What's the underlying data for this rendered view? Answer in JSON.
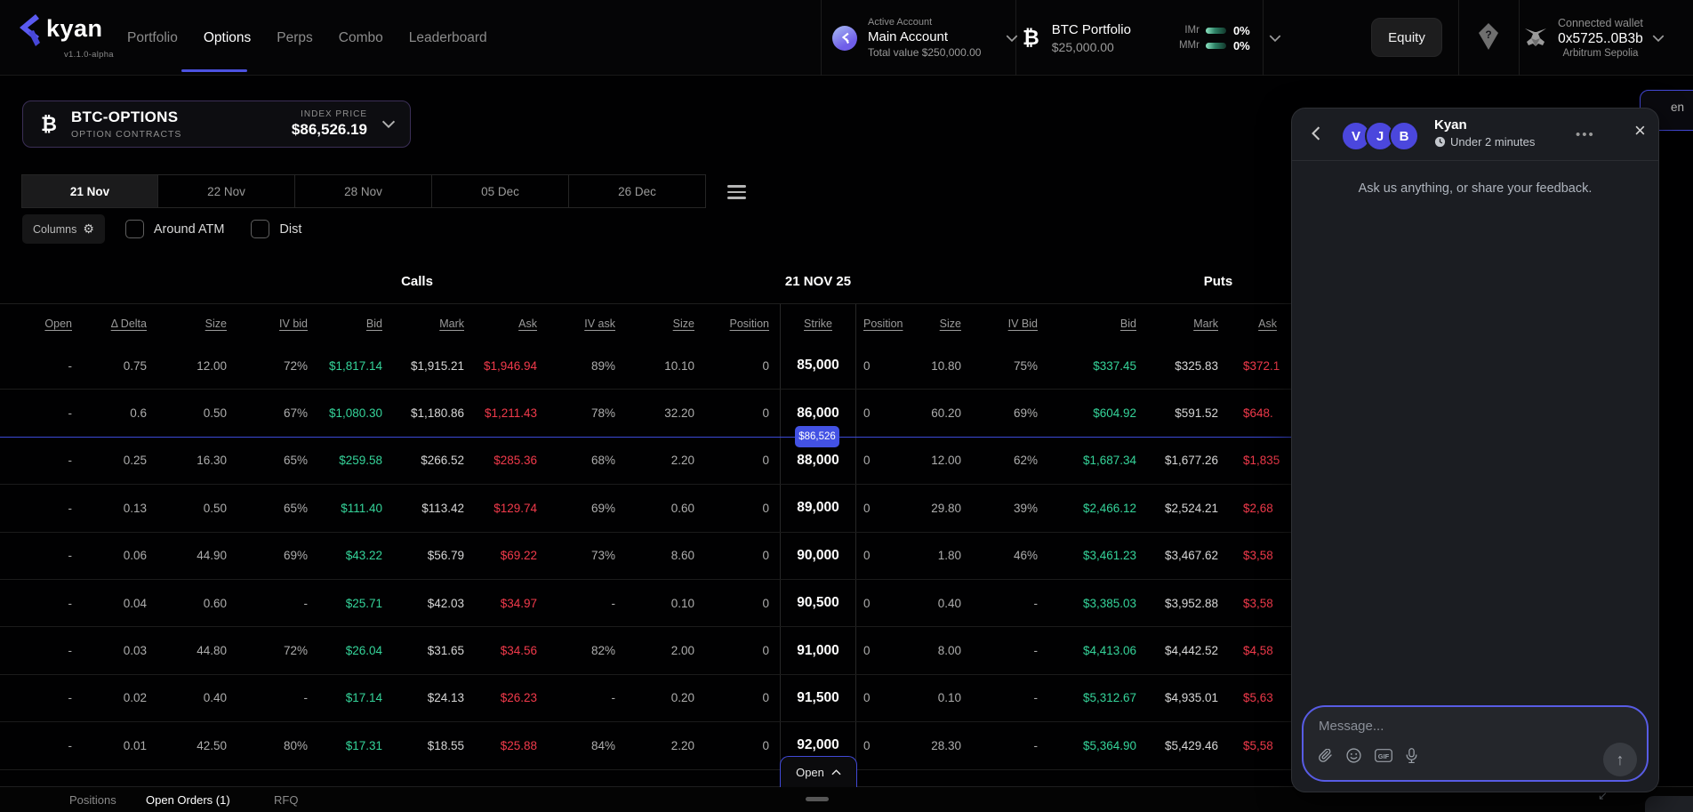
{
  "colors": {
    "accent_blue": "#4c52e0",
    "bid_green": "#35d49a",
    "ask_red": "#f13a4b",
    "badge_blue": "#4352e4"
  },
  "nav": {
    "brand": "kyan",
    "version": "v1.1.0-alpha",
    "items": [
      {
        "label": "Portfolio",
        "active": false
      },
      {
        "label": "Options",
        "active": true
      },
      {
        "label": "Perps",
        "active": false
      },
      {
        "label": "Combo",
        "active": false
      },
      {
        "label": "Leaderboard",
        "active": false
      }
    ],
    "account": {
      "label": "Active Account",
      "name": "Main Account",
      "total": "Total value $250,000.00"
    },
    "portfolio": {
      "name": "BTC Portfolio",
      "value": "$25,000.00",
      "imr_label": "IMr",
      "imr_value": "0%",
      "mmr_label": "MMr",
      "mmr_value": "0%",
      "btc_glyph": "₿"
    },
    "equity_button": "Equity",
    "help_icon": "?",
    "wallet": {
      "label": "Connected wallet",
      "address": "0x5725..0B3b",
      "network": "Arbitrum Sepolia"
    }
  },
  "market": {
    "btc_glyph": "₿",
    "name": "BTC-OPTIONS",
    "subtitle": "OPTION CONTRACTS",
    "index_label": "INDEX PRICE",
    "index_price": "$86,526.19"
  },
  "expiry_tabs": {
    "items": [
      "21 Nov",
      "22 Nov",
      "28 Nov",
      "05 Dec",
      "26 Dec"
    ],
    "active_index": 0
  },
  "filters": {
    "columns_label": "Columns",
    "around_atm_label": "Around ATM",
    "around_atm_checked": false,
    "dist_label": "Dist",
    "dist_checked": false
  },
  "chain": {
    "calls_label": "Calls",
    "expiry_label": "21 NOV 25",
    "puts_label": "Puts",
    "call_headers": [
      "Open",
      "Δ Delta",
      "Size",
      "IV bid",
      "Bid",
      "Mark",
      "Ask",
      "IV ask",
      "Size",
      "Position"
    ],
    "strike_header": "Strike",
    "put_headers": [
      "Position",
      "Size",
      "IV Bid",
      "Bid",
      "Mark",
      "Ask"
    ],
    "index_price_badge": "$86,526",
    "rows": [
      {
        "calls": [
          "-",
          "0.75",
          "12.00",
          "72%",
          "$1,817.14",
          "$1,915.21",
          "$1,946.94",
          "89%",
          "10.10",
          "0"
        ],
        "strike": "85,000",
        "puts": [
          "0",
          "10.80",
          "75%",
          "$337.45",
          "$325.83",
          "$372.1"
        ]
      },
      {
        "calls": [
          "-",
          "0.6",
          "0.50",
          "67%",
          "$1,080.30",
          "$1,180.86",
          "$1,211.43",
          "78%",
          "32.20",
          "0"
        ],
        "strike": "86,000",
        "puts": [
          "0",
          "60.20",
          "69%",
          "$604.92",
          "$591.52",
          "$648."
        ]
      },
      {
        "calls": [
          "-",
          "0.25",
          "16.30",
          "65%",
          "$259.58",
          "$266.52",
          "$285.36",
          "68%",
          "2.20",
          "0"
        ],
        "strike": "88,000",
        "puts": [
          "0",
          "12.00",
          "62%",
          "$1,687.34",
          "$1,677.26",
          "$1,835"
        ]
      },
      {
        "calls": [
          "-",
          "0.13",
          "0.50",
          "65%",
          "$111.40",
          "$113.42",
          "$129.74",
          "69%",
          "0.60",
          "0"
        ],
        "strike": "89,000",
        "puts": [
          "0",
          "29.80",
          "39%",
          "$2,466.12",
          "$2,524.21",
          "$2,68"
        ]
      },
      {
        "calls": [
          "-",
          "0.06",
          "44.90",
          "69%",
          "$43.22",
          "$56.79",
          "$69.22",
          "73%",
          "8.60",
          "0"
        ],
        "strike": "90,000",
        "puts": [
          "0",
          "1.80",
          "46%",
          "$3,461.23",
          "$3,467.62",
          "$3,58"
        ]
      },
      {
        "calls": [
          "-",
          "0.04",
          "0.60",
          "-",
          "$25.71",
          "$42.03",
          "$34.97",
          "-",
          "0.10",
          "0"
        ],
        "strike": "90,500",
        "puts": [
          "0",
          "0.40",
          "-",
          "$3,385.03",
          "$3,952.88",
          "$3,58"
        ]
      },
      {
        "calls": [
          "-",
          "0.03",
          "44.80",
          "72%",
          "$26.04",
          "$31.65",
          "$34.56",
          "82%",
          "2.00",
          "0"
        ],
        "strike": "91,000",
        "puts": [
          "0",
          "8.00",
          "-",
          "$4,413.06",
          "$4,442.52",
          "$4,58"
        ]
      },
      {
        "calls": [
          "-",
          "0.02",
          "0.40",
          "-",
          "$17.14",
          "$24.13",
          "$26.23",
          "-",
          "0.20",
          "0"
        ],
        "strike": "91,500",
        "puts": [
          "0",
          "0.10",
          "-",
          "$5,312.67",
          "$4,935.01",
          "$5,63"
        ]
      },
      {
        "calls": [
          "-",
          "0.01",
          "42.50",
          "80%",
          "$17.31",
          "$18.55",
          "$25.88",
          "84%",
          "2.20",
          "0"
        ],
        "strike": "92,000",
        "puts": [
          "0",
          "28.30",
          "-",
          "$5,364.90",
          "$5,429.46",
          "$5,58"
        ]
      }
    ],
    "index_row_after": 1
  },
  "open_button_label": "Open",
  "footer": {
    "tabs": [
      "Positions",
      "Open Orders (1)",
      "RFQ"
    ],
    "active_index": 1
  },
  "partial_button_text": "en",
  "chat": {
    "title": "Kyan",
    "response_time": "Under 2 minutes",
    "avatars": [
      "V",
      "J",
      "B"
    ],
    "greeting": "Ask us anything, or share your feedback.",
    "input_placeholder": "Message..."
  }
}
